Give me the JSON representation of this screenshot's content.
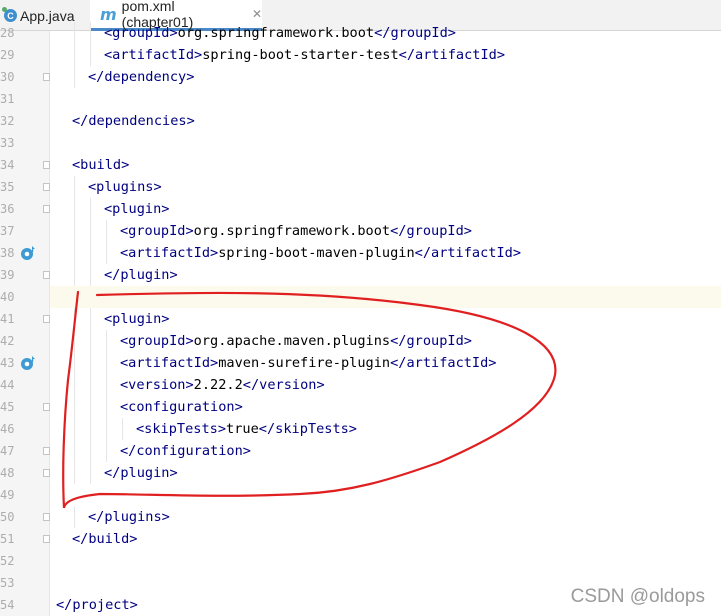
{
  "tabs": [
    {
      "label": "App.java",
      "icon": "java-class-icon"
    },
    {
      "label": "pom.xml (chapter01)",
      "icon": "maven-icon",
      "active": true
    }
  ],
  "editor": {
    "lines": [
      {
        "n": "28",
        "partial": true,
        "segs": [
          [
            "t",
            "<groupId>"
          ],
          [
            "x",
            "org.springframework.boot"
          ],
          [
            "t",
            "</groupId>"
          ]
        ]
      },
      {
        "n": "29",
        "segs": [
          [
            "t",
            "<artifactId>"
          ],
          [
            "x",
            "spring-boot-starter-test"
          ],
          [
            "t",
            "</artifactId>"
          ]
        ]
      },
      {
        "n": "30",
        "segs": [
          [
            "t",
            "</dependency>"
          ]
        ]
      },
      {
        "n": "31",
        "segs": []
      },
      {
        "n": "32",
        "segs": [
          [
            "t",
            "</dependencies>"
          ]
        ]
      },
      {
        "n": "33",
        "segs": []
      },
      {
        "n": "34",
        "segs": [
          [
            "t",
            "<build>"
          ]
        ]
      },
      {
        "n": "35",
        "segs": [
          [
            "t",
            "<plugins>"
          ]
        ]
      },
      {
        "n": "36",
        "segs": [
          [
            "t",
            "<plugin>"
          ]
        ]
      },
      {
        "n": "37",
        "segs": [
          [
            "t",
            "<groupId>"
          ],
          [
            "x",
            "org.springframework.boot"
          ],
          [
            "t",
            "</groupId>"
          ]
        ]
      },
      {
        "n": "38",
        "segs": [
          [
            "t",
            "<artifactId>"
          ],
          [
            "x",
            "spring-boot-maven-plugin"
          ],
          [
            "t",
            "</artifactId>"
          ]
        ]
      },
      {
        "n": "39",
        "segs": [
          [
            "t",
            "</plugin>"
          ]
        ]
      },
      {
        "n": "40",
        "segs": []
      },
      {
        "n": "41",
        "segs": [
          [
            "t",
            "<plugin>"
          ]
        ]
      },
      {
        "n": "42",
        "segs": [
          [
            "t",
            "<groupId>"
          ],
          [
            "x",
            "org.apache.maven.plugins"
          ],
          [
            "t",
            "</groupId>"
          ]
        ]
      },
      {
        "n": "43",
        "segs": [
          [
            "t",
            "<artifactId>"
          ],
          [
            "x",
            "maven-surefire-plugin"
          ],
          [
            "t",
            "</artifactId>"
          ]
        ]
      },
      {
        "n": "44",
        "segs": [
          [
            "t",
            "<version>"
          ],
          [
            "x",
            "2.22.2"
          ],
          [
            "t",
            "</version>"
          ]
        ]
      },
      {
        "n": "45",
        "segs": [
          [
            "t",
            "<configuration>"
          ]
        ]
      },
      {
        "n": "46",
        "segs": [
          [
            "t",
            "<skipTests>"
          ],
          [
            "x",
            "true"
          ],
          [
            "t",
            "</skipTests>"
          ]
        ]
      },
      {
        "n": "47",
        "segs": [
          [
            "t",
            "</configuration>"
          ]
        ]
      },
      {
        "n": "48",
        "segs": [
          [
            "t",
            "</plugin>"
          ]
        ]
      },
      {
        "n": "49",
        "segs": []
      },
      {
        "n": "50",
        "segs": [
          [
            "t",
            "</plugins>"
          ]
        ]
      },
      {
        "n": "51",
        "segs": [
          [
            "t",
            "</build>"
          ]
        ]
      },
      {
        "n": "52",
        "segs": []
      },
      {
        "n": "53",
        "segs": []
      },
      {
        "n": "54",
        "segs": [
          [
            "t",
            "</project>"
          ]
        ]
      }
    ],
    "current_line": "40"
  },
  "watermark": "CSDN @oldops",
  "colors": {
    "tag": "#000080",
    "text": "#000000",
    "annotation": "#e02020"
  }
}
